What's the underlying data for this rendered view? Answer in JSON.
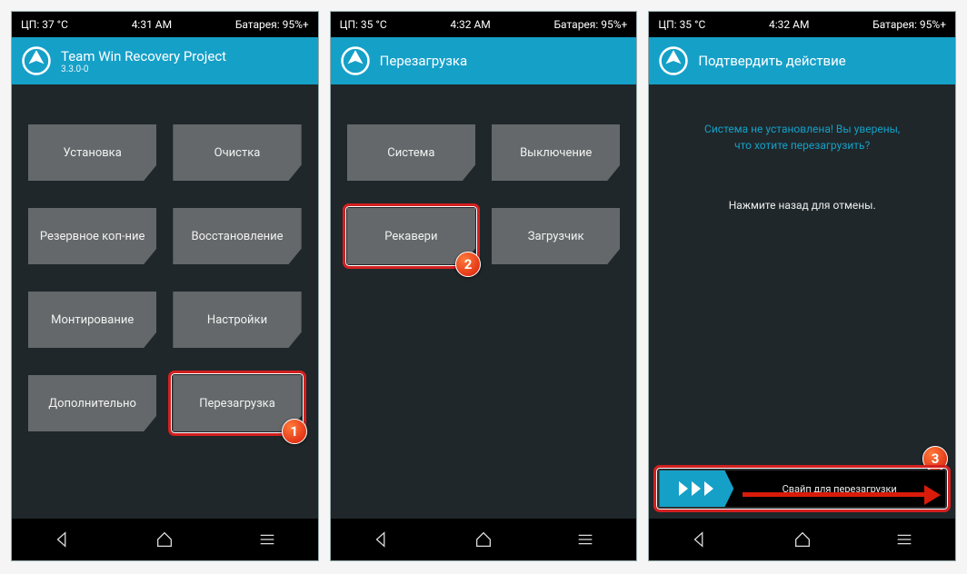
{
  "screens": [
    {
      "status": {
        "cpu": "ЦП: 37 °C",
        "time": "4:31 AM",
        "battery": "Батарея: 95%+"
      },
      "header": {
        "title": "Team Win Recovery Project",
        "subtitle": "3.3.0-0"
      },
      "tiles": [
        "Установка",
        "Очистка",
        "Резервное коп-ние",
        "Восстановление",
        "Монтирование",
        "Настройки",
        "Дополнительно",
        "Перезагрузка"
      ],
      "highlight_index": 7,
      "marker": "1"
    },
    {
      "status": {
        "cpu": "ЦП: 35 °C",
        "time": "4:32 AM",
        "battery": "Батарея: 95%+"
      },
      "header": {
        "title": "Перезагрузка",
        "subtitle": ""
      },
      "tiles": [
        "Система",
        "Выключение",
        "Рекавери",
        "Загрузчик"
      ],
      "highlight_index": 2,
      "marker": "2"
    },
    {
      "status": {
        "cpu": "ЦП: 35 °C",
        "time": "4:32 AM",
        "battery": "Батарея: 95%+"
      },
      "header": {
        "title": "Подтвердить действие",
        "subtitle": ""
      },
      "confirm": {
        "line1": "Система не установлена! Вы уверены,",
        "line2": "что хотите перезагрузить?",
        "back": "Нажмите назад для отмены."
      },
      "slider_label": "Свайп для перезагрузки",
      "marker": "3"
    }
  ]
}
